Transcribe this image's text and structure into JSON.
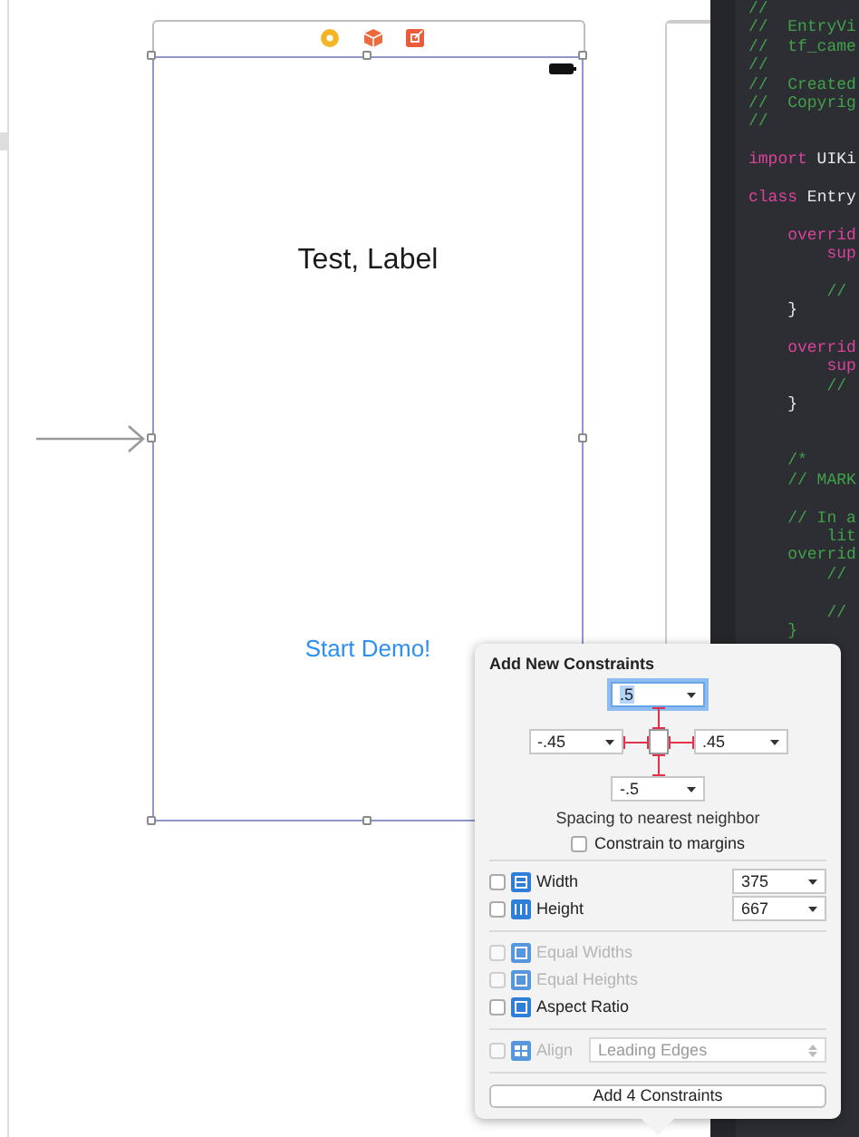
{
  "scene": {
    "label_text": "Test, Label",
    "button_text": "Start Demo!"
  },
  "code_editor": {
    "lines": [
      {
        "kind": "code",
        "segments": [
          {
            "text": "//",
            "kind": "comment"
          }
        ]
      },
      {
        "kind": "code",
        "segments": [
          {
            "text": "//  EntryVi",
            "kind": "comment"
          }
        ]
      },
      {
        "kind": "code",
        "segments": [
          {
            "text": "//  tf_came",
            "kind": "comment"
          }
        ]
      },
      {
        "kind": "code",
        "segments": [
          {
            "text": "//",
            "kind": "comment"
          }
        ]
      },
      {
        "kind": "code",
        "segments": [
          {
            "text": "//  Created",
            "kind": "comment"
          }
        ]
      },
      {
        "kind": "code",
        "segments": [
          {
            "text": "//  Copyrig",
            "kind": "comment"
          }
        ]
      },
      {
        "kind": "code",
        "segments": [
          {
            "text": "//",
            "kind": "comment"
          }
        ]
      },
      {
        "kind": "blank"
      },
      {
        "kind": "code",
        "segments": [
          {
            "text": "import",
            "kind": "keyword"
          },
          {
            "text": " UIKi",
            "kind": "plain"
          }
        ]
      },
      {
        "kind": "blank"
      },
      {
        "kind": "code",
        "segments": [
          {
            "text": "class",
            "kind": "keyword"
          },
          {
            "text": " Entry",
            "kind": "plain"
          }
        ]
      },
      {
        "kind": "blank"
      },
      {
        "kind": "code",
        "segments": [
          {
            "text": "    overrid",
            "kind": "keyword"
          }
        ]
      },
      {
        "kind": "code",
        "segments": [
          {
            "text": "        sup",
            "kind": "keyword"
          }
        ]
      },
      {
        "kind": "blank"
      },
      {
        "kind": "code",
        "segments": [
          {
            "text": "        //",
            "kind": "comment"
          }
        ]
      },
      {
        "kind": "code",
        "segments": [
          {
            "text": "    }",
            "kind": "plain"
          }
        ]
      },
      {
        "kind": "blank"
      },
      {
        "kind": "code",
        "segments": [
          {
            "text": "    overrid",
            "kind": "keyword"
          }
        ]
      },
      {
        "kind": "code",
        "segments": [
          {
            "text": "        sup",
            "kind": "keyword"
          }
        ]
      },
      {
        "kind": "code",
        "segments": [
          {
            "text": "        //",
            "kind": "comment"
          }
        ]
      },
      {
        "kind": "code",
        "segments": [
          {
            "text": "    }",
            "kind": "plain"
          }
        ]
      },
      {
        "kind": "blank"
      },
      {
        "kind": "blank"
      },
      {
        "kind": "code",
        "segments": [
          {
            "text": "    /*",
            "kind": "comment"
          }
        ]
      },
      {
        "kind": "code",
        "segments": [
          {
            "text": "    // MARK",
            "kind": "comment"
          }
        ]
      },
      {
        "kind": "blank"
      },
      {
        "kind": "code",
        "segments": [
          {
            "text": "    // In a",
            "kind": "comment"
          }
        ]
      },
      {
        "kind": "code",
        "segments": [
          {
            "text": "        lit",
            "kind": "comment"
          }
        ]
      },
      {
        "kind": "code",
        "segments": [
          {
            "text": "    overrid",
            "kind": "comment"
          }
        ]
      },
      {
        "kind": "code",
        "segments": [
          {
            "text": "        //",
            "kind": "comment"
          }
        ]
      },
      {
        "kind": "blank"
      },
      {
        "kind": "code",
        "segments": [
          {
            "text": "        //",
            "kind": "comment"
          }
        ]
      },
      {
        "kind": "code",
        "segments": [
          {
            "text": "    }",
            "kind": "comment"
          }
        ]
      }
    ]
  },
  "popover": {
    "title": "Add New Constraints",
    "spacing": {
      "top": {
        "value": ".5",
        "focused": true
      },
      "left": {
        "value": "-.45",
        "focused": false
      },
      "right": {
        "value": ".45",
        "focused": false
      },
      "bottom": {
        "value": "-.5",
        "focused": false
      }
    },
    "spacing_caption": "Spacing to nearest neighbor",
    "constrain_to_margins": {
      "label": "Constrain to margins",
      "checked": false
    },
    "size_rows": [
      {
        "label": "Width",
        "checked": false,
        "value": "375"
      },
      {
        "label": "Height",
        "checked": false,
        "value": "667"
      }
    ],
    "relation_rows": [
      {
        "label": "Equal Widths",
        "checked": false,
        "disabled": true
      },
      {
        "label": "Equal Heights",
        "checked": false,
        "disabled": true
      },
      {
        "label": "Aspect Ratio",
        "checked": false,
        "disabled": false
      }
    ],
    "align": {
      "label": "Align",
      "value": "Leading Edges",
      "checked": false,
      "disabled": true
    },
    "add_button": "Add 4 Constraints"
  }
}
